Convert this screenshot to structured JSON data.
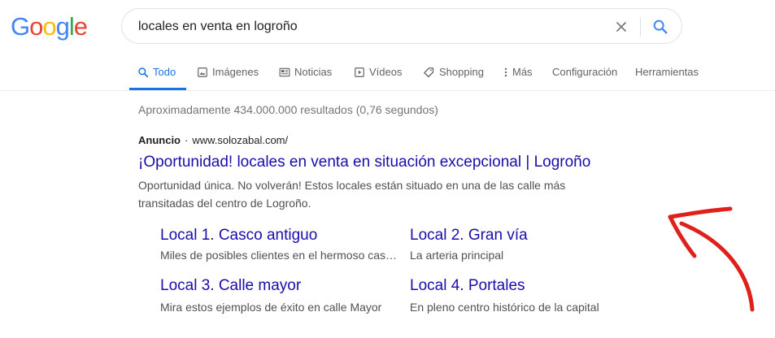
{
  "logo": {
    "letters": [
      "G",
      "o",
      "o",
      "g",
      "l",
      "e"
    ],
    "colors": [
      "#4285f4",
      "#ea4335",
      "#fbbc05",
      "#4285f4",
      "#34a853",
      "#ea4335"
    ]
  },
  "search": {
    "query": "locales en venta en logroño",
    "clear_icon": "close-icon",
    "submit_icon": "search-icon"
  },
  "tabs": [
    {
      "label": "Todo",
      "icon": "search-icon",
      "active": true
    },
    {
      "label": "Imágenes",
      "icon": "image-icon",
      "active": false
    },
    {
      "label": "Noticias",
      "icon": "news-icon",
      "active": false
    },
    {
      "label": "Vídeos",
      "icon": "play-icon",
      "active": false
    },
    {
      "label": "Shopping",
      "icon": "tag-icon",
      "active": false
    },
    {
      "label": "Más",
      "icon": "more-vert-icon",
      "active": false
    },
    {
      "label": "Configuración",
      "icon": "",
      "active": false
    },
    {
      "label": "Herramientas",
      "icon": "",
      "active": false
    }
  ],
  "results_stats": "Aproximadamente 434.000.000 resultados (0,76 segundos)",
  "ad": {
    "label": "Anuncio",
    "separator": "·",
    "url": "www.solozabal.com/",
    "title": "¡Oportunidad! locales en venta en situación excepcional | Logroño",
    "description": "Oportunidad única. No volverán! Estos locales están situado en una de las calle más transitadas del centro de Logroño.",
    "sitelinks": [
      {
        "title": "Local 1. Casco antiguo",
        "description": "Miles de posibles clientes en el hermoso casco antiguo"
      },
      {
        "title": "Local 2. Gran vía",
        "description": "La arteria principal"
      },
      {
        "title": "Local 3. Calle mayor",
        "description": "Mira estos ejemplos de éxito en calle Mayor"
      },
      {
        "title": "Local 4. Portales",
        "description": "En pleno centro histórico de la capital"
      }
    ]
  },
  "colors": {
    "link": "#1a0dab",
    "accent": "#1a73e8",
    "annotation_arrow": "#e0201b"
  }
}
